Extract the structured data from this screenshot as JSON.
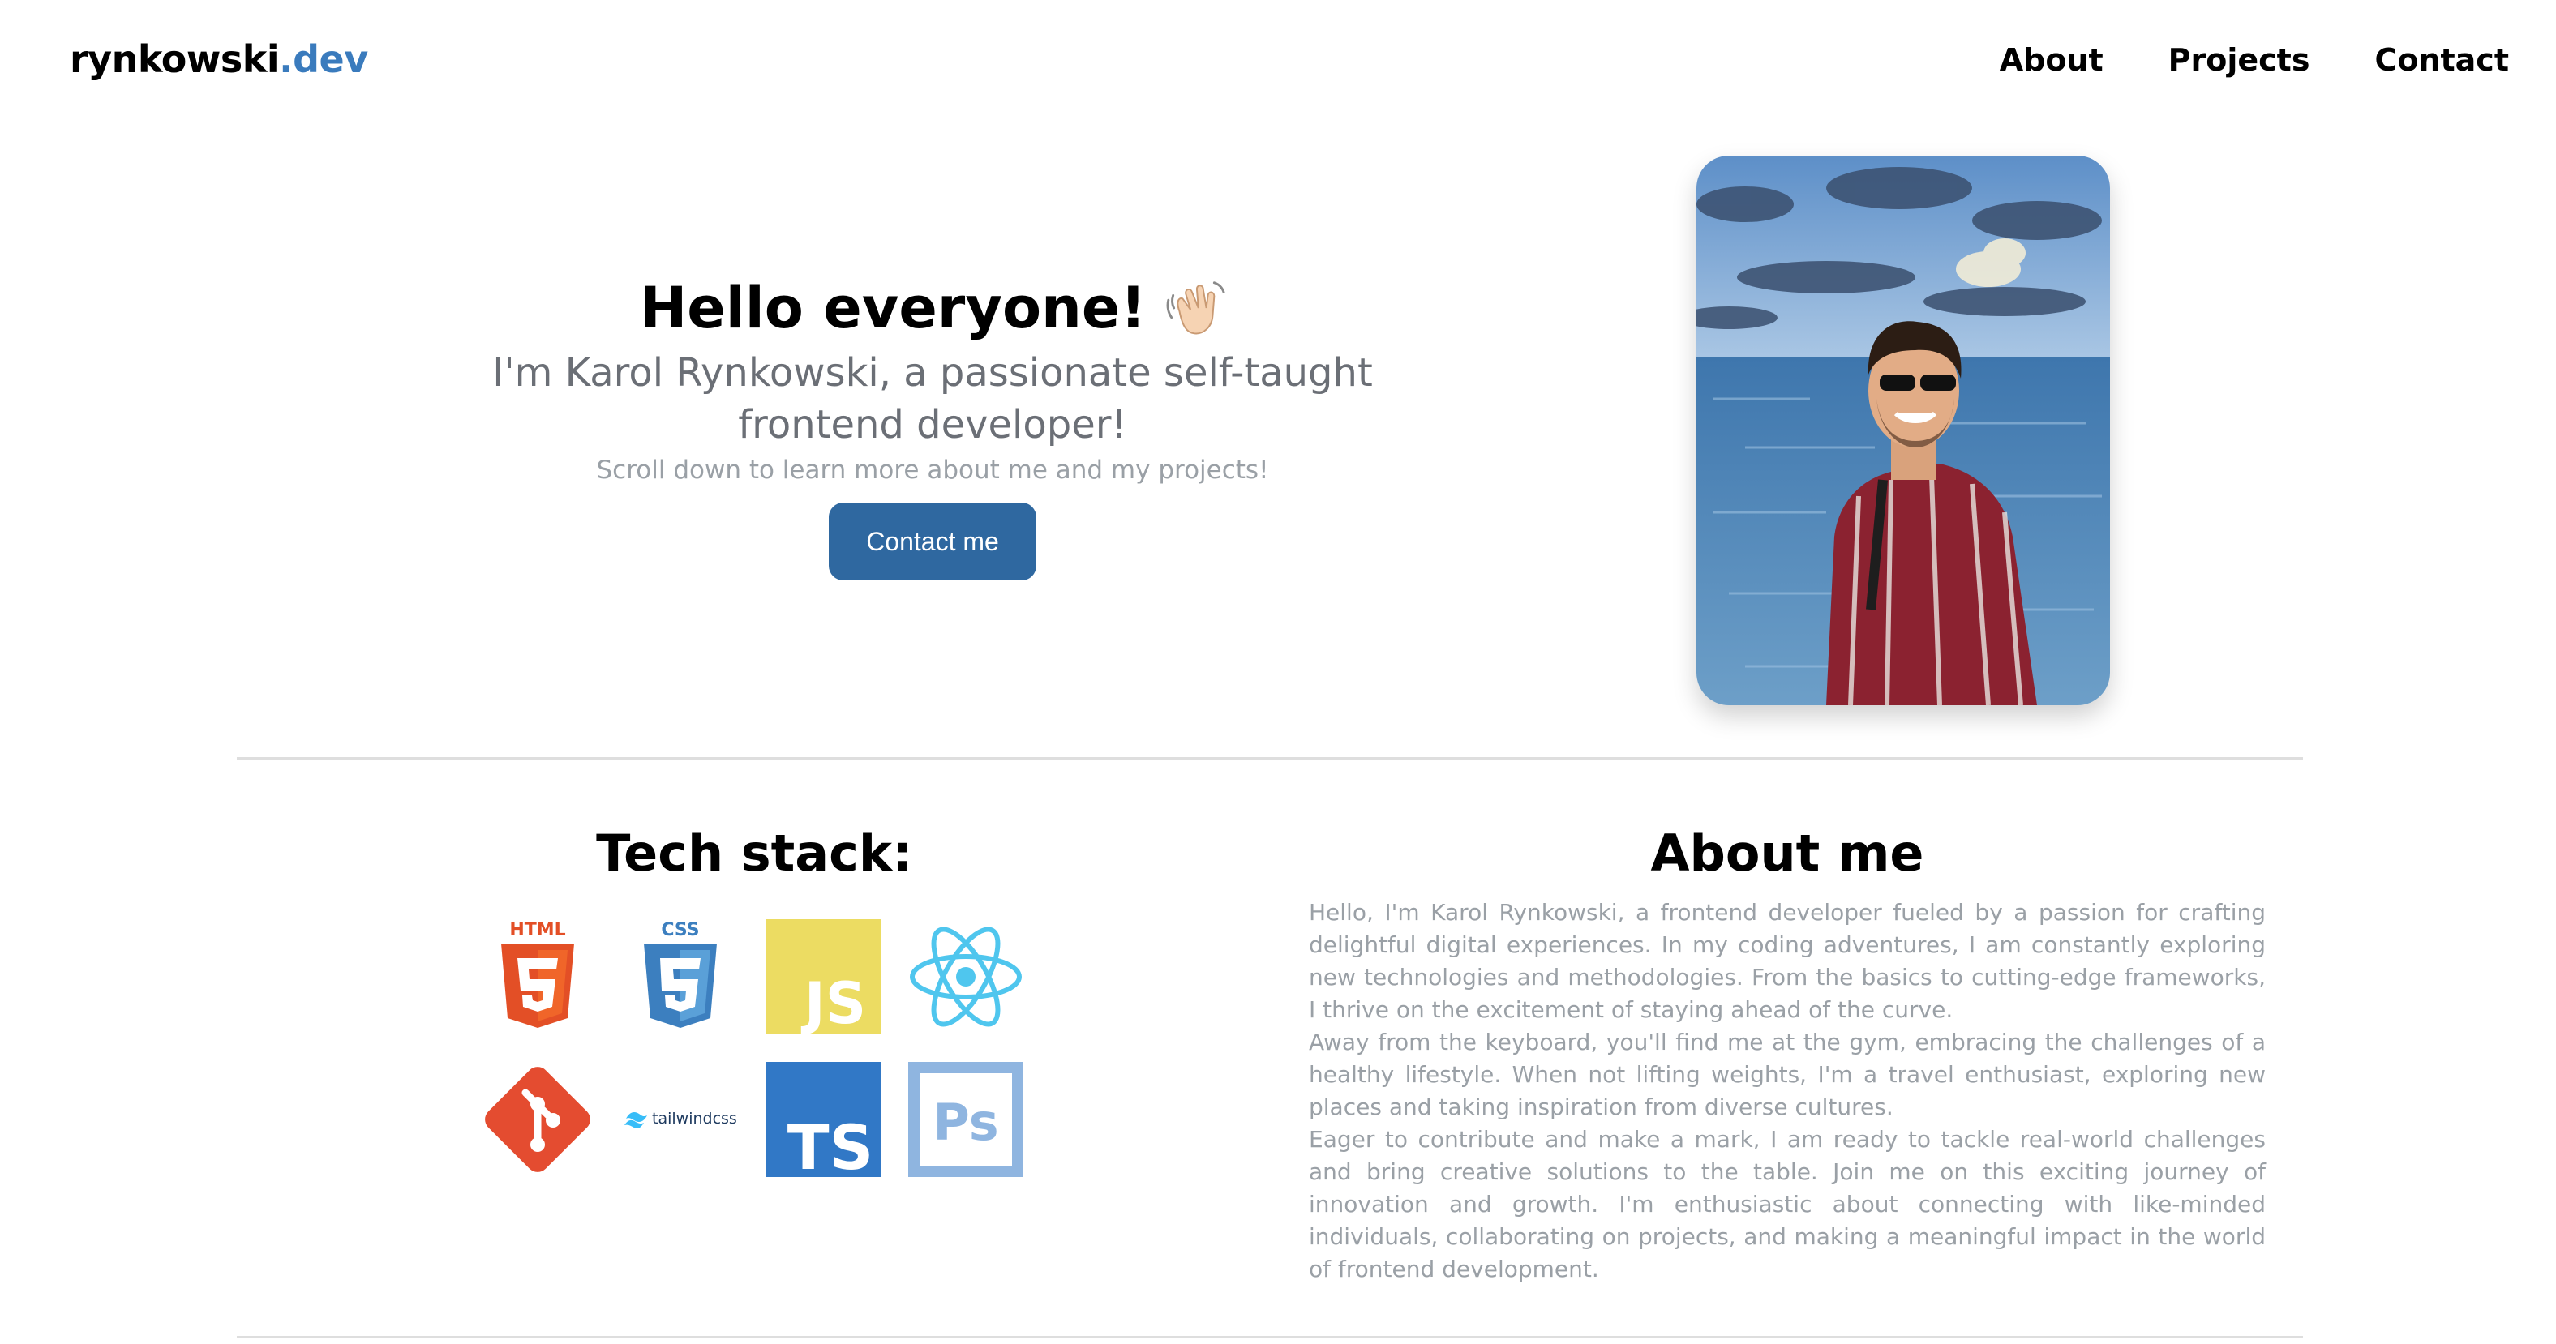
{
  "header": {
    "logo_main": "rynkowski",
    "logo_suffix": ".dev",
    "nav": [
      {
        "label": "About"
      },
      {
        "label": "Projects"
      },
      {
        "label": "Contact"
      }
    ]
  },
  "hero": {
    "title": "Hello everyone!",
    "title_icon": "waving-hand-icon",
    "subtitle": "I'm Karol Rynkowski, a passionate self-taught frontend developer!",
    "hint": "Scroll down to learn more about me and my projects!",
    "cta_label": "Contact me",
    "photo_icon": "profile-photo"
  },
  "tech": {
    "title": "Tech stack:",
    "icons": [
      "html5-icon",
      "css3-icon",
      "javascript-icon",
      "react-icon",
      "git-icon",
      "tailwindcss-icon",
      "typescript-icon",
      "photoshop-icon"
    ],
    "labels": {
      "html": "HTML",
      "css": "CSS",
      "js": "JS",
      "tailwind": "tailwindcss",
      "ts": "TS",
      "ps": "Ps"
    }
  },
  "about": {
    "title": "About me",
    "paragraphs": [
      "Hello, I'm Karol Rynkowski, a frontend developer fueled by a passion for crafting delightful digital experiences. In my coding adventures, I am constantly exploring new technologies and methodologies. From the basics to cutting-edge frameworks, I thrive on the excitement of staying ahead of the curve.",
      "Away from the keyboard, you'll find me at the gym, embracing the challenges of a healthy lifestyle. When not lifting weights, I'm a travel enthusiast, exploring new places and taking inspiration from diverse cultures.",
      "Eager to contribute and make a mark, I am ready to tackle real-world challenges and bring creative solutions to the table. Join me on this exciting journey of innovation and growth. I'm enthusiastic about connecting with like-minded individuals, collaborating on projects, and making a meaningful impact in the world of frontend development."
    ]
  },
  "colors": {
    "accent": "#3a7bbd",
    "button": "#2f68a0",
    "muted_text": "#9aa0a6",
    "subtitle_text": "#6b6f76"
  }
}
